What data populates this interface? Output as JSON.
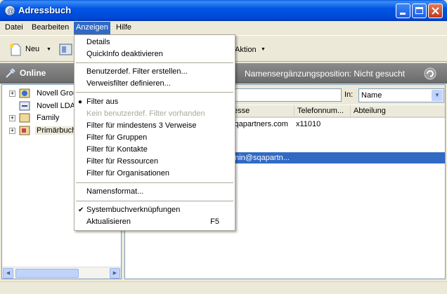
{
  "window": {
    "title": "Adressbuch"
  },
  "menubar": {
    "items": [
      {
        "label": "Datei"
      },
      {
        "label": "Bearbeiten"
      },
      {
        "label": "Anzeigen"
      },
      {
        "label": "Hilfe"
      }
    ]
  },
  "toolbar": {
    "new_label": "Neu",
    "action_label": "Aktion"
  },
  "onlinebar": {
    "status": "Online",
    "name_completion": "Namensergänzungsposition: Nicht gesucht"
  },
  "tree": {
    "items": [
      {
        "label": "Novell Grou"
      },
      {
        "label": "Novell LDAI"
      },
      {
        "label": "Family"
      },
      {
        "label": "Primärbuch"
      }
    ]
  },
  "search": {
    "in_label": "In:",
    "in_value": "Name"
  },
  "table": {
    "columns": [
      "esse",
      "Telefonnum...",
      "Abteilung"
    ],
    "rows": [
      {
        "email": "sqapartners.com",
        "phone": "x11010"
      },
      {
        "email": "unin@sqapartn..."
      }
    ]
  },
  "dropdown": {
    "items": [
      {
        "label": "Details"
      },
      {
        "label": "QuickInfo deaktivieren"
      },
      {
        "label": "Benutzerdef. Filter erstellen..."
      },
      {
        "label": "Verweisfilter definieren..."
      },
      {
        "label": "Filter aus",
        "checked": true
      },
      {
        "label": "Kein benutzerdef. Filter vorhanden",
        "disabled": true
      },
      {
        "label": "Filter für mindestens 3 Verweise"
      },
      {
        "label": "Filter für Gruppen"
      },
      {
        "label": "Filter für Kontakte"
      },
      {
        "label": "Filter für Ressourcen"
      },
      {
        "label": "Filter für Organisationen"
      },
      {
        "label": "Namensformat..."
      },
      {
        "label": "Systembuchverknüpfungen",
        "checked": true
      },
      {
        "label": "Aktualisieren",
        "shortcut": "F5"
      }
    ]
  },
  "colors": {
    "title_blue": "#0055e5",
    "menu_highlight": "#316ac5",
    "selected_row": "#316ac5",
    "online_bar": "#7a7a7a"
  }
}
